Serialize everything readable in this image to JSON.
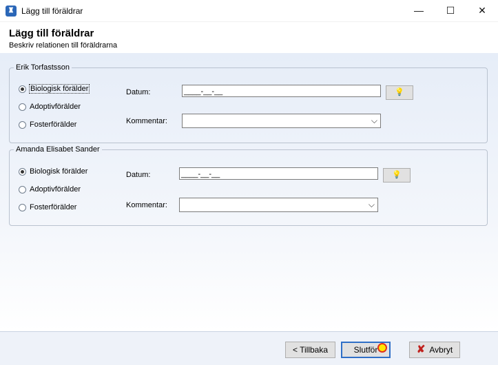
{
  "window": {
    "title": "Lägg till föräldrar",
    "controls": {
      "minimize": "—",
      "maximize": "☐",
      "close": "✕"
    }
  },
  "header": {
    "title": "Lägg till föräldrar",
    "subtitle": "Beskriv relationen till föräldrarna"
  },
  "parents": [
    {
      "name": "Erik  Torfastsson",
      "options": [
        "Biologisk förälder",
        "Adoptivförälder",
        "Fosterförälder"
      ],
      "selected_index": 0,
      "date_label": "Datum:",
      "date_value": "____-__-__",
      "comment_label": "Kommentar:",
      "comment_value": ""
    },
    {
      "name": "Amanda Elisabet Sander",
      "options": [
        "Biologisk förälder",
        "Adoptivförälder",
        "Fosterförälder"
      ],
      "selected_index": 0,
      "date_label": "Datum:",
      "date_value": "____-__-__",
      "comment_label": "Kommentar:",
      "comment_value": ""
    }
  ],
  "footer": {
    "back_label": "< Tillbaka",
    "finish_label": "Slutför",
    "cancel_label": "Avbryt"
  },
  "icons": {
    "app": "family-tree-icon",
    "date_picker": "lightbulb-icon",
    "cancel": "red-x-icon"
  }
}
